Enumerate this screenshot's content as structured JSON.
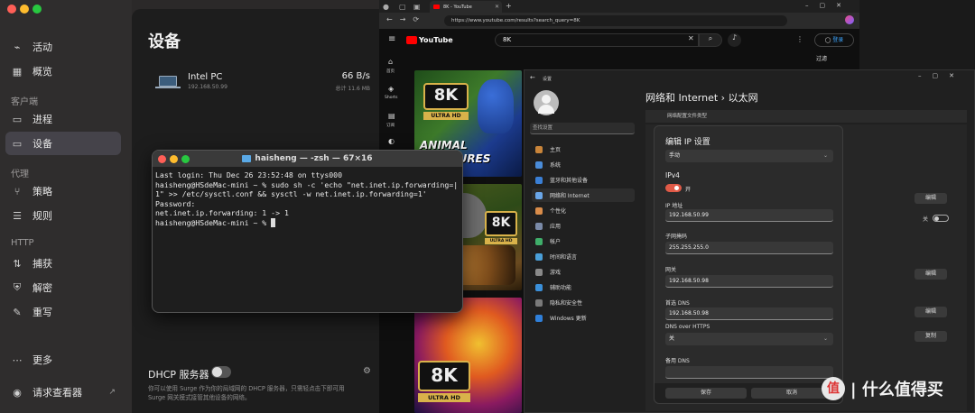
{
  "surge": {
    "nav": {
      "activity": "活动",
      "overview": "概览",
      "client_section": "客户端",
      "process": "进程",
      "devices": "设备",
      "proxy_section": "代理",
      "policy": "策略",
      "rules": "规则",
      "http_section": "HTTP",
      "capture": "捕获",
      "decrypt": "解密",
      "rewrite": "重写",
      "more": "更多",
      "request_viewer": "请求查看器"
    },
    "page_title": "设备",
    "device": {
      "name": "Intel PC",
      "ip": "192.168.50.99",
      "speed": "66 B/s",
      "total": "总计 11.6 MB"
    },
    "dhcp": {
      "title": "DHCP 服务器",
      "desc_line1": "你可以使用 Surge 作为你的局域网的 DHCP 服务器，只需轻点击下即可用",
      "desc_line2": "Surge 网关模式接管其他设备的网络。"
    }
  },
  "terminal": {
    "title": "haisheng — -zsh — 67×16",
    "lines": [
      "Last login: Thu Dec 26 23:52:48 on ttys000",
      "haisheng@HSdeMac-mini ~ % sudo sh -c 'echo \"net.inet.ip.forwarding=|",
      "1\" >> /etc/sysctl.conf && sysctl -w net.inet.ip.forwarding=1'",
      "Password:",
      "net.inet.ip.forwarding: 1 -> 1",
      "haisheng@HSdeMac-mini ~ % "
    ]
  },
  "browser": {
    "tab_title": "8K - YouTube",
    "url": "https://www.youtube.com/results?search_query=8K",
    "search_query": "8K",
    "logo": "YouTube",
    "signin": "登录",
    "filter": "过滤",
    "yt_nav": [
      "首页",
      "Shorts",
      "订阅",
      "你"
    ],
    "thumbs": [
      {
        "badge": "8K",
        "sub": "ULTRA HD",
        "caption": "ANIMAL CREATURES"
      },
      {
        "badge": "8K",
        "sub": "ULTRA HD",
        "caption": ""
      },
      {
        "badge": "8K",
        "sub": "ULTRA HD",
        "caption": ""
      }
    ]
  },
  "settings": {
    "window_title": "设置",
    "search_placeholder": "查找设置",
    "breadcrumb": "网络和 Internet  ›  以太网",
    "section_label": "网络配置文件类型",
    "nav": [
      "主页",
      "系统",
      "蓝牙和其他设备",
      "网络和 Internet",
      "个性化",
      "应用",
      "帐户",
      "时间和语言",
      "游戏",
      "辅助功能",
      "隐私和安全性",
      "Windows 更新"
    ],
    "right_buttons": [
      "编辑",
      "编辑",
      "编辑",
      "复制"
    ],
    "toggle_label": "关",
    "dialog": {
      "title": "编辑 IP 设置",
      "mode": "手动",
      "ipv4_label": "IPv4",
      "ipv4_state": "开",
      "ip_label": "IP 地址",
      "ip_value": "192.168.50.99",
      "mask_label": "子网掩码",
      "mask_value": "255.255.255.0",
      "gateway_label": "网关",
      "gateway_value": "192.168.50.98",
      "dns_label": "首选 DNS",
      "dns_value": "192.168.50.98",
      "doh_label": "DNS over HTTPS",
      "doh_value": "关",
      "alt_dns_label": "备用 DNS",
      "save": "保存",
      "cancel": "取消"
    }
  },
  "watermark": "值 | 什么值得买",
  "colors": {
    "accent": "#e05a47",
    "active_nav": "#45434a"
  }
}
